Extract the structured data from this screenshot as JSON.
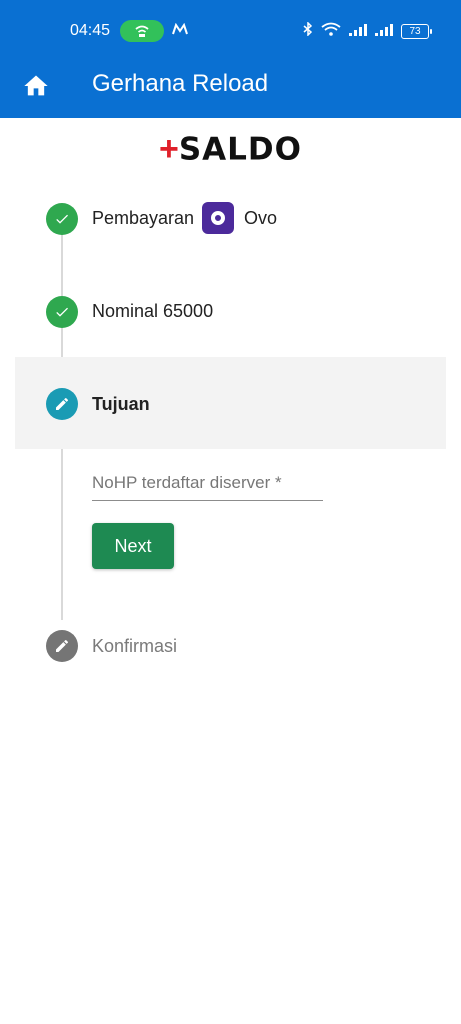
{
  "status_bar": {
    "time": "04:45",
    "battery": "73",
    "icons": [
      "hotspot-icon",
      "m-app-icon",
      "bluetooth-icon",
      "wifi-icon",
      "signal-icon",
      "signal-icon",
      "battery-icon"
    ]
  },
  "app_bar": {
    "title": "Gerhana Reload",
    "home_icon": "home-icon"
  },
  "logo": {
    "plus": "+",
    "text": "SALDO"
  },
  "stepper": {
    "steps": [
      {
        "label": "Pembayaran",
        "extra": "Ovo",
        "state": "done"
      },
      {
        "label": "Nominal 65000",
        "state": "done"
      },
      {
        "label": "Tujuan",
        "state": "active"
      },
      {
        "label": "Konfirmasi",
        "state": "pending"
      }
    ],
    "input_placeholder": "NoHP terdaftar diserver *",
    "input_value": "",
    "next_label": "Next"
  },
  "colors": {
    "primary": "#0a70d2",
    "done": "#2fa84f",
    "active": "#1a9bb4",
    "pending": "#757575",
    "button": "#1e8a52"
  }
}
